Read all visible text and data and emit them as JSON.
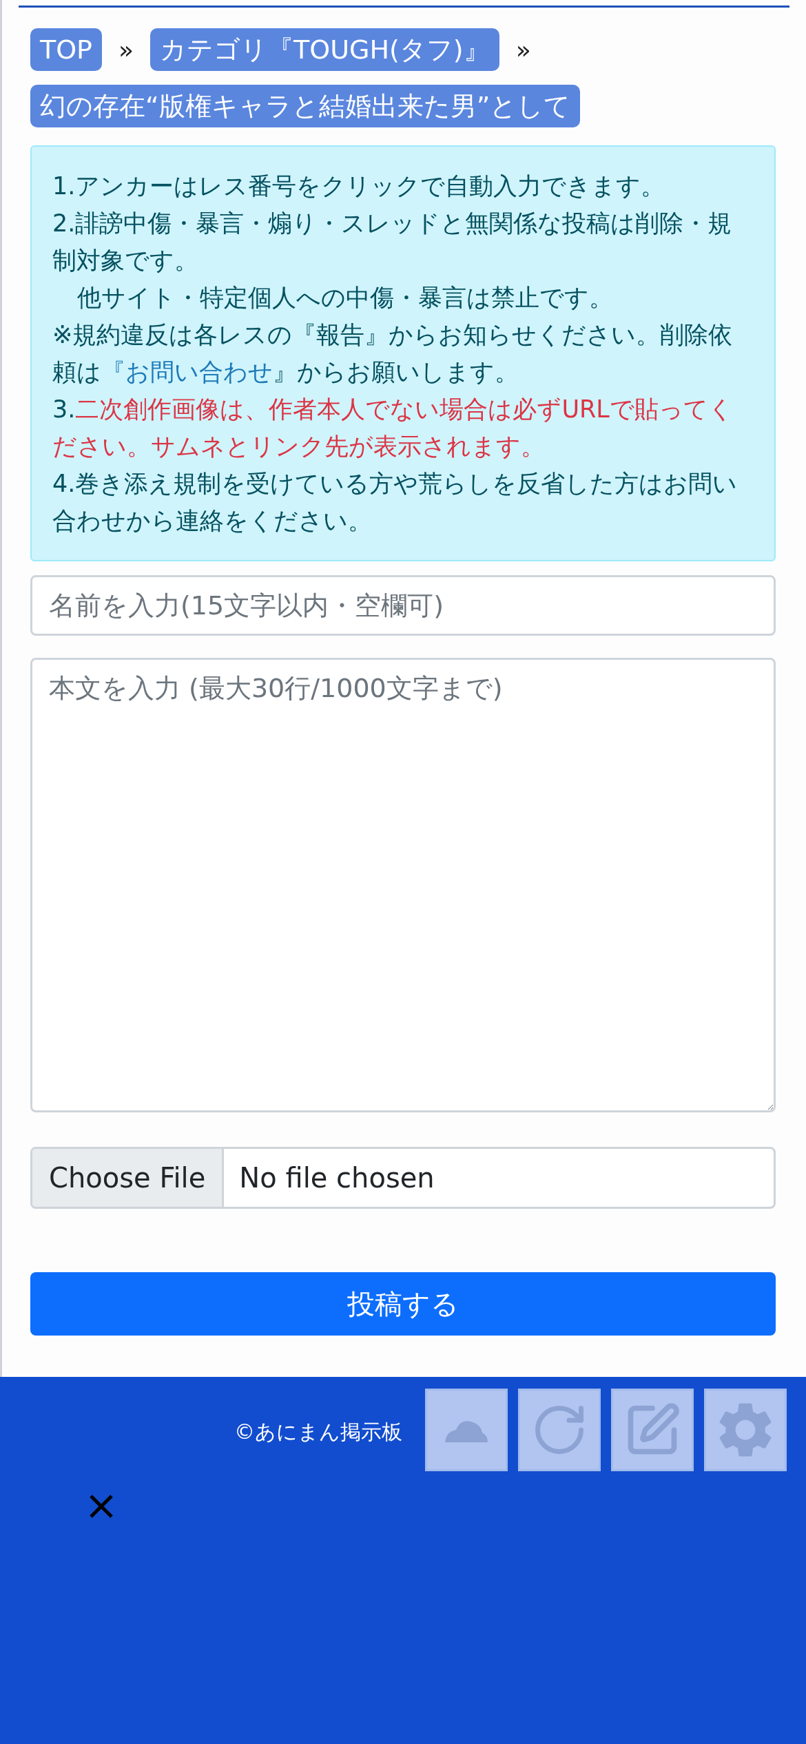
{
  "breadcrumbs": [
    {
      "label": "TOP",
      "separator": "»"
    },
    {
      "label": "カテゴリ『TOUGH(タフ)』",
      "separator": "»"
    },
    {
      "label": "幻の存在“版権キャラと結婚出来た男”として"
    }
  ],
  "notice": [
    {
      "indented": false,
      "parts": [
        {
          "kind": "plain",
          "text": "1.アンカーはレス番号をクリックで自動入力できます。"
        }
      ]
    },
    {
      "indented": false,
      "parts": [
        {
          "kind": "plain",
          "text": "2.誹謗中傷・暴言・煽り・スレッドと無関係な投稿は削除・規制対象です。"
        }
      ]
    },
    {
      "indented": true,
      "parts": [
        {
          "kind": "plain",
          "text": "他サイト・特定個人への中傷・暴言は禁止です。"
        }
      ]
    },
    {
      "indented": false,
      "parts": [
        {
          "kind": "plain",
          "text": "※規約違反は各レスの『報告』からお知らせください。削除依頼は"
        },
        {
          "kind": "link",
          "text": "『お問い合わせ"
        },
        {
          "kind": "plain",
          "text": "』からお願いします。"
        }
      ]
    },
    {
      "indented": false,
      "parts": [
        {
          "kind": "plain",
          "text": "3."
        },
        {
          "kind": "warning",
          "text": "二次創作画像は、作者本人でない場合は必ずURLで貼ってください。サムネとリンク先が表示されます。"
        }
      ]
    },
    {
      "indented": false,
      "parts": [
        {
          "kind": "plain",
          "text": "4.巻き添え規制を受けている方や荒らしを反省した方はお問い合わせから連絡をください。"
        }
      ]
    }
  ],
  "form": {
    "name": {
      "placeholder": "名前を入力(15文字以内・空欄可)"
    },
    "body": {
      "placeholder": "本文を入力 (最大30行/1000文字まで)"
    },
    "file": {
      "button": "Choose File",
      "status": "No file chosen"
    },
    "submit": "投稿する"
  },
  "footer": {
    "copyright": "©あにまん掲示板"
  }
}
